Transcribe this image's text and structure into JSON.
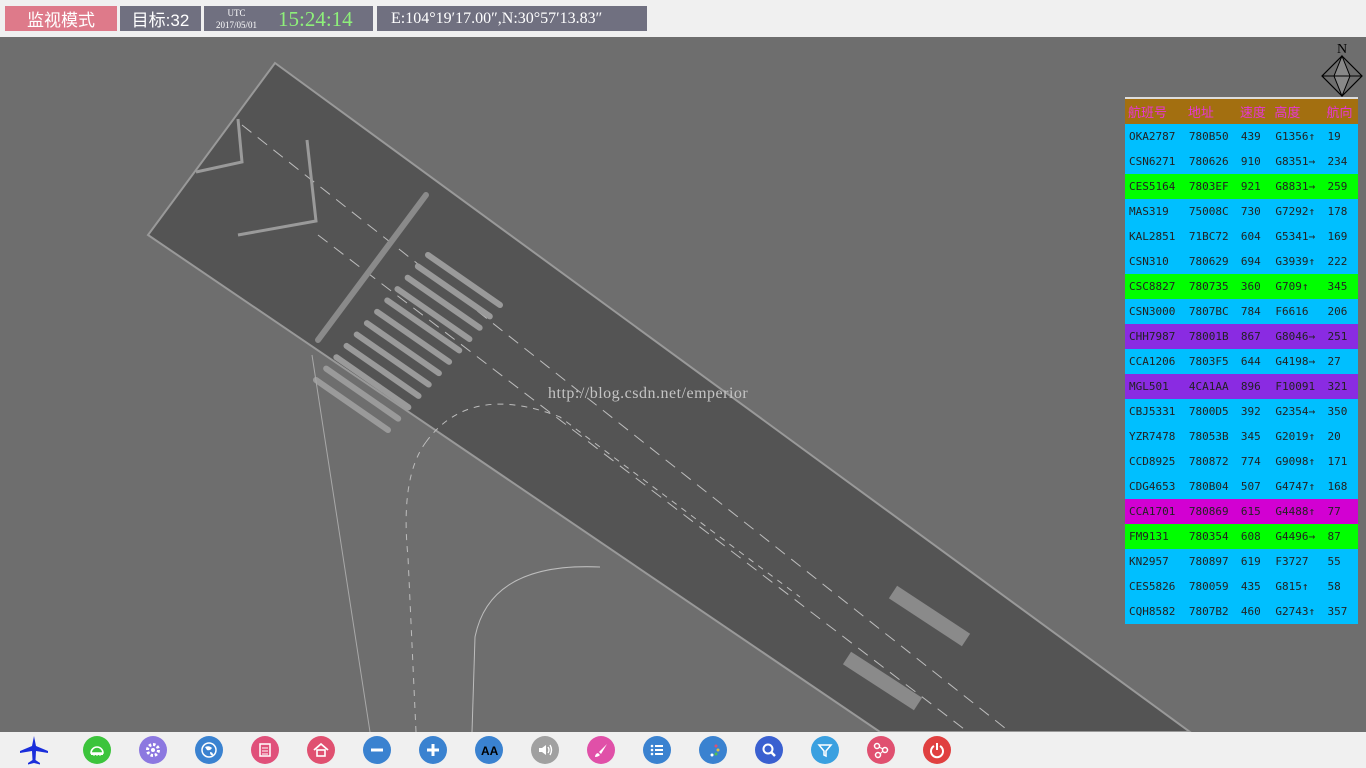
{
  "header": {
    "mode": "监视模式",
    "targets": "目标:32",
    "utc_label": "UTC",
    "utc_date": "2017/05/01",
    "clock": "15:24:14",
    "coords": "E:104°19′17.00″,N:30°57′13.83″"
  },
  "map": {
    "watermark": "http://blog.csdn.net/emperior",
    "compass_label": "N"
  },
  "table": {
    "headers": [
      "航班号",
      "地址",
      "速度",
      "高度",
      "航向"
    ],
    "rows": [
      {
        "c": [
          "OKA2787",
          "780B50",
          "439",
          "G1356↑",
          "19"
        ],
        "color": "cyan"
      },
      {
        "c": [
          "CSN6271",
          "780626",
          "910",
          "G8351→",
          "234"
        ],
        "color": "cyan"
      },
      {
        "c": [
          "CES5164",
          "7803EF",
          "921",
          "G8831→",
          "259"
        ],
        "color": "green"
      },
      {
        "c": [
          "MAS319",
          "75008C",
          "730",
          "G7292↑",
          "178"
        ],
        "color": "cyan"
      },
      {
        "c": [
          "KAL2851",
          "71BC72",
          "604",
          "G5341→",
          "169"
        ],
        "color": "cyan"
      },
      {
        "c": [
          "CSN310",
          "780629",
          "694",
          "G3939↑",
          "222"
        ],
        "color": "cyan"
      },
      {
        "c": [
          "CSC8827",
          "780735",
          "360",
          "G709↑",
          "345"
        ],
        "color": "green"
      },
      {
        "c": [
          "CSN3000",
          "7807BC",
          "784",
          "F6616",
          "206"
        ],
        "color": "cyan"
      },
      {
        "c": [
          "CHH7987",
          "78001B",
          "867",
          "G8046→",
          "251"
        ],
        "color": "purple"
      },
      {
        "c": [
          "CCA1206",
          "7803F5",
          "644",
          "G4198→",
          "27"
        ],
        "color": "cyan"
      },
      {
        "c": [
          "MGL501",
          "4CA1AA",
          "896",
          "F10091",
          "321"
        ],
        "color": "purple"
      },
      {
        "c": [
          "CBJ5331",
          "7800D5",
          "392",
          "G2354→",
          "350"
        ],
        "color": "cyan"
      },
      {
        "c": [
          "YZR7478",
          "78053B",
          "345",
          "G2019↑",
          "20"
        ],
        "color": "cyan"
      },
      {
        "c": [
          "CCD8925",
          "780872",
          "774",
          "G9098↑",
          "171"
        ],
        "color": "cyan"
      },
      {
        "c": [
          "CDG4653",
          "780B04",
          "507",
          "G4747↑",
          "168"
        ],
        "color": "cyan"
      },
      {
        "c": [
          "CCA1701",
          "780869",
          "615",
          "G4488↑",
          "77"
        ],
        "color": "magenta"
      },
      {
        "c": [
          "FM9131",
          "780354",
          "608",
          "G4496→",
          "87"
        ],
        "color": "green"
      },
      {
        "c": [
          "KN2957",
          "780897",
          "619",
          "F3727",
          "55"
        ],
        "color": "cyan"
      },
      {
        "c": [
          "CES5826",
          "780059",
          "435",
          "G815↑",
          "58"
        ],
        "color": "cyan"
      },
      {
        "c": [
          "CQH8582",
          "7807B2",
          "460",
          "G2743↑",
          "357"
        ],
        "color": "cyan"
      }
    ]
  },
  "toolbar": [
    {
      "name": "plane-icon",
      "color": "#1a2edb"
    },
    {
      "name": "radar-icon",
      "color": "#3cc43c"
    },
    {
      "name": "gear-icon",
      "color": "#8c78e0"
    },
    {
      "name": "globe-icon",
      "color": "#3a82d0"
    },
    {
      "name": "notepad-icon",
      "color": "#e0507a"
    },
    {
      "name": "home-icon",
      "color": "#e05070"
    },
    {
      "name": "zoom-out-icon",
      "color": "#3a82d0"
    },
    {
      "name": "zoom-in-icon",
      "color": "#3a82d0"
    },
    {
      "name": "font-size-icon",
      "color": "#3a82d0"
    },
    {
      "name": "volume-icon",
      "color": "#a0a0a0"
    },
    {
      "name": "brush-icon",
      "color": "#e050a8"
    },
    {
      "name": "list-icon",
      "color": "#3a82d0"
    },
    {
      "name": "palette-icon",
      "color": "#3a82d0"
    },
    {
      "name": "search-icon",
      "color": "#3a60d0"
    },
    {
      "name": "filter-icon",
      "color": "#3aa0e0"
    },
    {
      "name": "share-icon",
      "color": "#e05070"
    },
    {
      "name": "power-icon",
      "color": "#e04040"
    }
  ]
}
